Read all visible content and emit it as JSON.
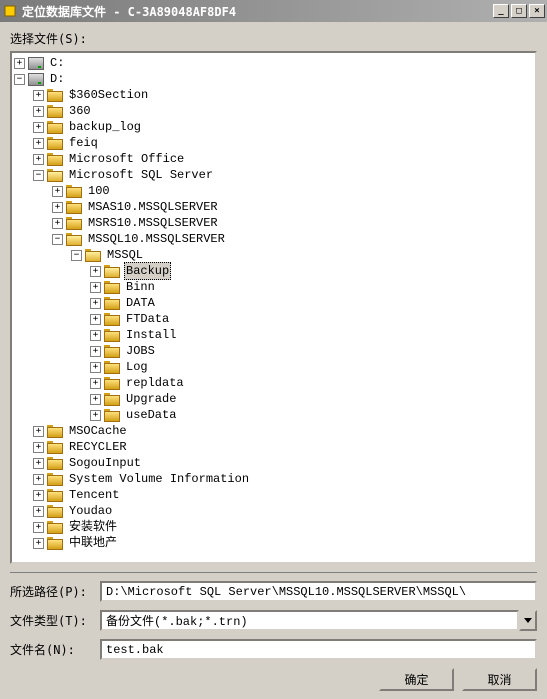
{
  "titlebar": {
    "title": "定位数据库文件 - C-3A89048AF8DF4",
    "min": "_",
    "max": "□",
    "close": "×"
  },
  "labels": {
    "select_file": "选择文件(S):",
    "selected_path": "所选路径(P):",
    "file_type": "文件类型(T):",
    "file_name": "文件名(N):"
  },
  "tree": [
    {
      "depth": 0,
      "toggle": "plus",
      "icon": "drive",
      "label": "C:"
    },
    {
      "depth": 0,
      "toggle": "minus",
      "icon": "drive",
      "label": "D:"
    },
    {
      "depth": 1,
      "toggle": "plus",
      "icon": "folder",
      "label": "$360Section"
    },
    {
      "depth": 1,
      "toggle": "plus",
      "icon": "folder",
      "label": "360"
    },
    {
      "depth": 1,
      "toggle": "plus",
      "icon": "folder",
      "label": "backup_log"
    },
    {
      "depth": 1,
      "toggle": "plus",
      "icon": "folder",
      "label": "feiq"
    },
    {
      "depth": 1,
      "toggle": "plus",
      "icon": "folder",
      "label": "Microsoft Office"
    },
    {
      "depth": 1,
      "toggle": "minus",
      "icon": "folder-open",
      "label": "Microsoft SQL Server"
    },
    {
      "depth": 2,
      "toggle": "plus",
      "icon": "folder",
      "label": "100"
    },
    {
      "depth": 2,
      "toggle": "plus",
      "icon": "folder",
      "label": "MSAS10.MSSQLSERVER"
    },
    {
      "depth": 2,
      "toggle": "plus",
      "icon": "folder",
      "label": "MSRS10.MSSQLSERVER"
    },
    {
      "depth": 2,
      "toggle": "minus",
      "icon": "folder-open",
      "label": "MSSQL10.MSSQLSERVER"
    },
    {
      "depth": 3,
      "toggle": "minus",
      "icon": "folder-open",
      "label": "MSSQL"
    },
    {
      "depth": 4,
      "toggle": "plus",
      "icon": "folder-open",
      "label": "Backup",
      "selected": true
    },
    {
      "depth": 4,
      "toggle": "plus",
      "icon": "folder",
      "label": "Binn"
    },
    {
      "depth": 4,
      "toggle": "plus",
      "icon": "folder",
      "label": "DATA"
    },
    {
      "depth": 4,
      "toggle": "plus",
      "icon": "folder",
      "label": "FTData"
    },
    {
      "depth": 4,
      "toggle": "plus",
      "icon": "folder",
      "label": "Install"
    },
    {
      "depth": 4,
      "toggle": "plus",
      "icon": "folder",
      "label": "JOBS"
    },
    {
      "depth": 4,
      "toggle": "plus",
      "icon": "folder",
      "label": "Log"
    },
    {
      "depth": 4,
      "toggle": "plus",
      "icon": "folder",
      "label": "repldata"
    },
    {
      "depth": 4,
      "toggle": "plus",
      "icon": "folder",
      "label": "Upgrade"
    },
    {
      "depth": 4,
      "toggle": "plus",
      "icon": "folder",
      "label": "useData"
    },
    {
      "depth": 1,
      "toggle": "plus",
      "icon": "folder",
      "label": "MSOCache"
    },
    {
      "depth": 1,
      "toggle": "plus",
      "icon": "folder",
      "label": "RECYCLER"
    },
    {
      "depth": 1,
      "toggle": "plus",
      "icon": "folder",
      "label": "SogouInput"
    },
    {
      "depth": 1,
      "toggle": "plus",
      "icon": "folder",
      "label": "System Volume Information"
    },
    {
      "depth": 1,
      "toggle": "plus",
      "icon": "folder",
      "label": "Tencent"
    },
    {
      "depth": 1,
      "toggle": "plus",
      "icon": "folder",
      "label": "Youdao"
    },
    {
      "depth": 1,
      "toggle": "plus",
      "icon": "folder",
      "label": "安装软件"
    },
    {
      "depth": 1,
      "toggle": "plus",
      "icon": "folder",
      "label": "中联地产"
    }
  ],
  "form": {
    "path_value": "D:\\Microsoft SQL Server\\MSSQL10.MSSQLSERVER\\MSSQL\\",
    "type_value": "备份文件(*.bak;*.trn)",
    "name_value": "test.bak"
  },
  "buttons": {
    "ok": "确定",
    "cancel": "取消"
  }
}
